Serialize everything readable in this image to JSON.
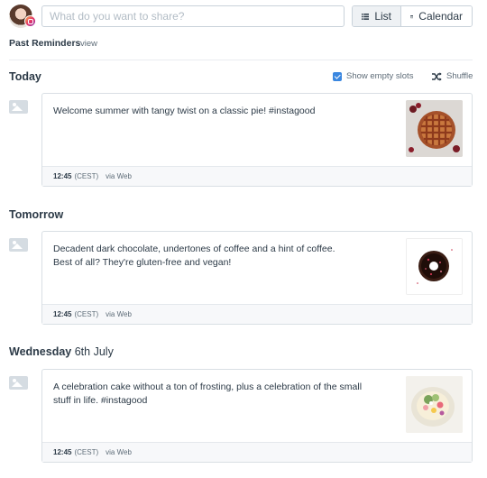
{
  "composer": {
    "placeholder": "What do you want to share?"
  },
  "view_toggle": {
    "list_label": "List",
    "calendar_label": "Calendar",
    "active": "list"
  },
  "past_reminders": {
    "label": "Past Reminders",
    "link": "view"
  },
  "options": {
    "show_empty_slots_label": "Show empty slots",
    "show_empty_slots_checked": true,
    "shuffle_label": "Shuffle"
  },
  "days": [
    {
      "title": "Today",
      "subtitle": "",
      "post": {
        "text_lines": [
          "Welcome summer with tangy twist on a classic pie! #instagood"
        ],
        "time": "12:45",
        "timezone": "(CEST)",
        "via": "via Web",
        "image_icon": "cherry-pie-photo"
      }
    },
    {
      "title": "Tomorrow",
      "subtitle": "",
      "post": {
        "text_lines": [
          "Decadent dark chocolate, undertones of coffee and a hint of coffee.",
          "Best of all? They're gluten-free and vegan!"
        ],
        "time": "12:45",
        "timezone": "(CEST)",
        "via": "via Web",
        "image_icon": "chocolate-donut-photo"
      }
    },
    {
      "title": "Wednesday",
      "subtitle": "6th July",
      "post": {
        "text_lines": [
          "A celebration cake without a ton of frosting, plus a celebration of the small",
          "stuff in life. #instagood"
        ],
        "time": "12:45",
        "timezone": "(CEST)",
        "via": "via Web",
        "image_icon": "celebration-cake-photo"
      }
    }
  ],
  "colors": {
    "accent": "#3a87e0",
    "text": "#2c3a47",
    "muted": "#5e6c78",
    "border": "#d9dfe4",
    "footer_bg": "#f7f8fa"
  }
}
